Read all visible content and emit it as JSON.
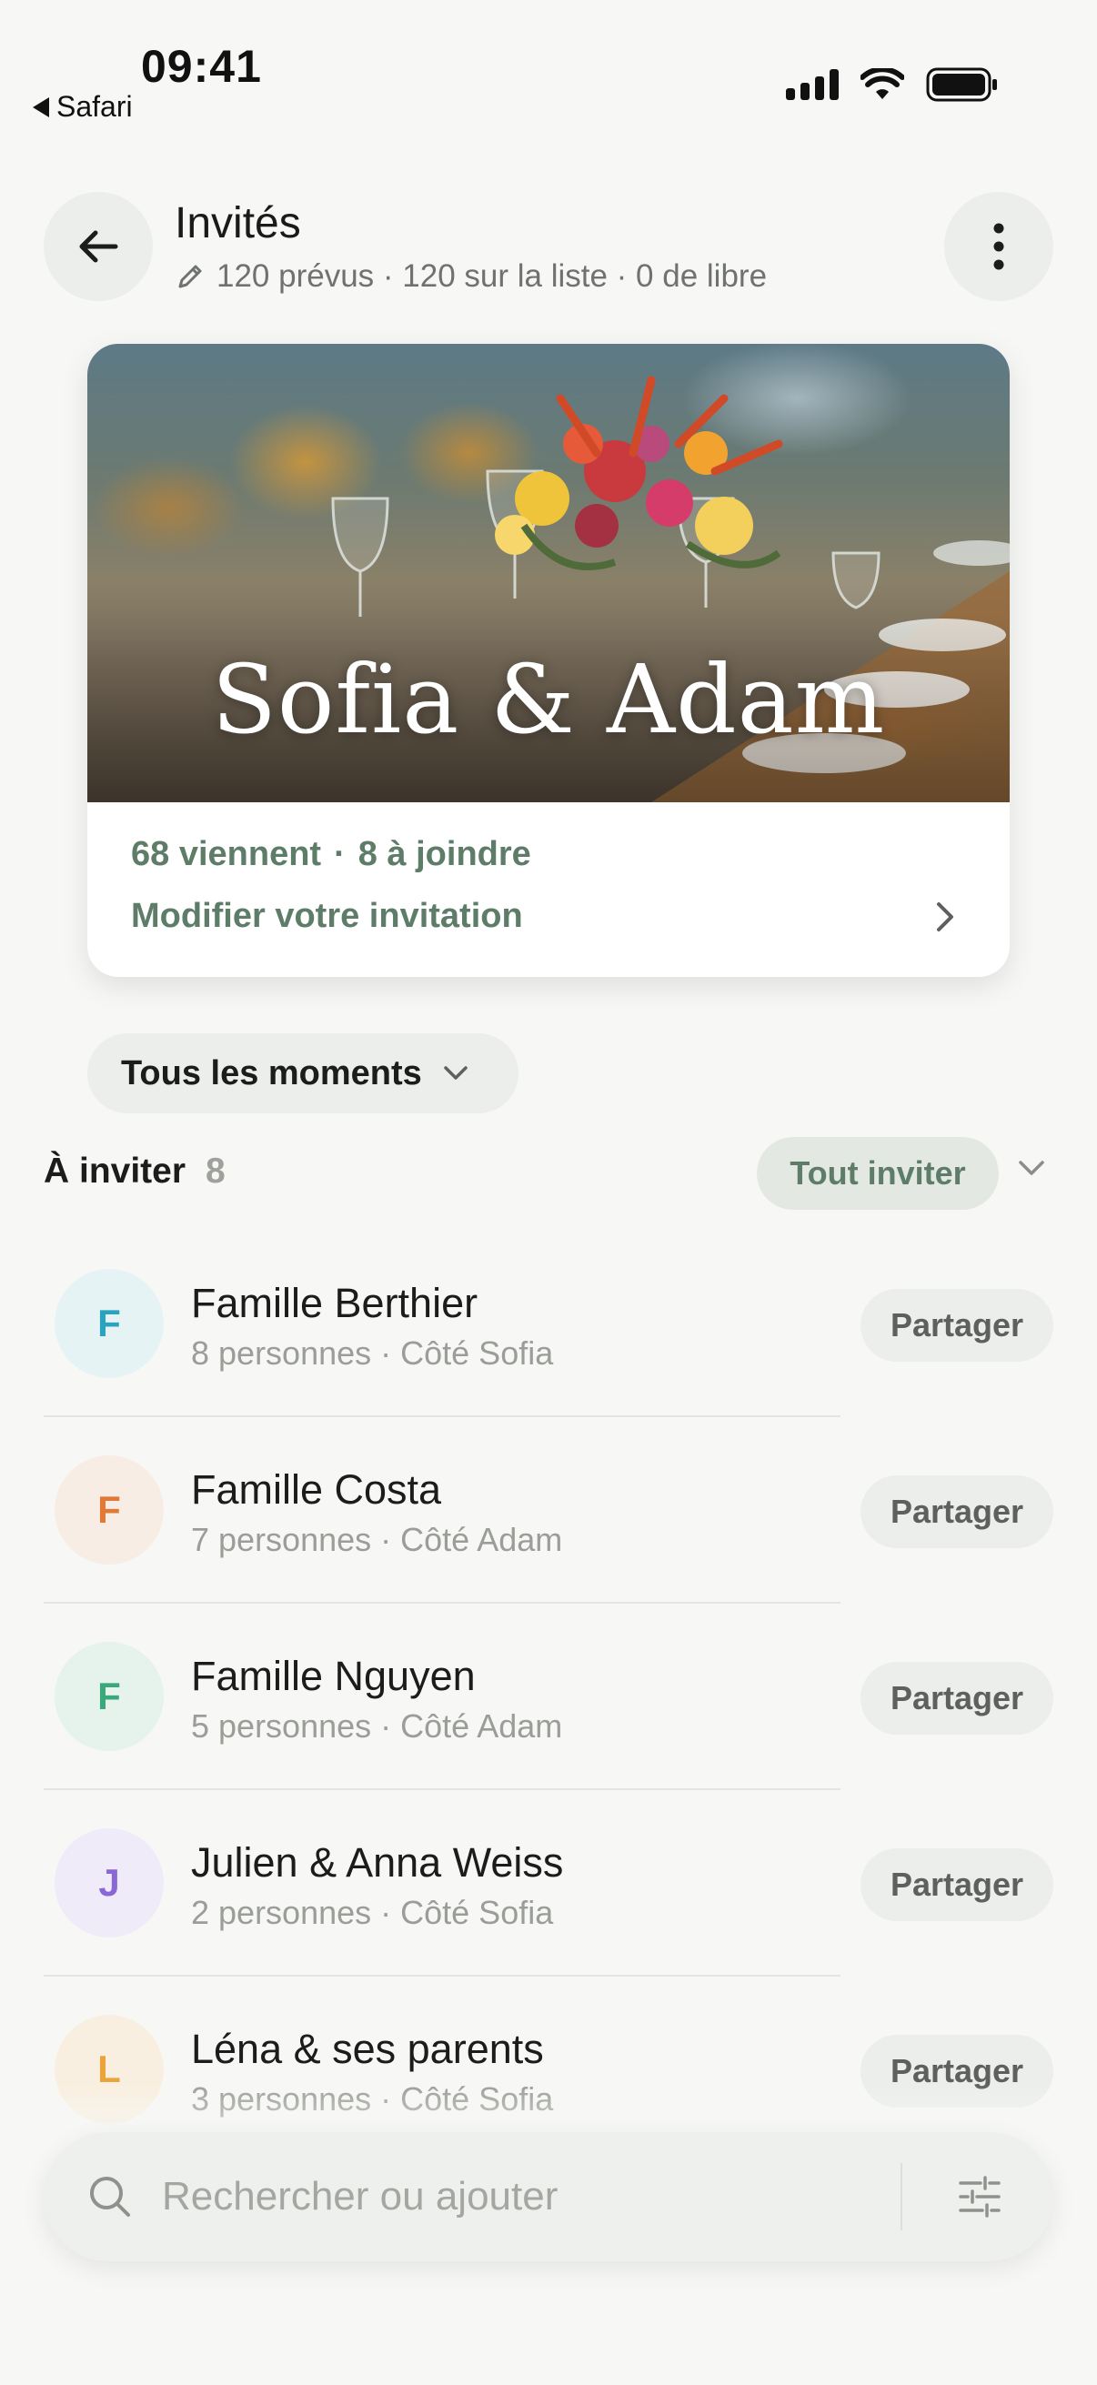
{
  "status_bar": {
    "time": "09:41",
    "back_app": "Safari"
  },
  "header": {
    "title": "Invités",
    "subtitle": "120 prévus · 120 sur la liste · 0 de libre",
    "back_icon": "arrow-left-icon",
    "more_icon": "more-vertical-icon",
    "edit_icon": "pencil-icon"
  },
  "event": {
    "title": "Sofia & Adam",
    "stat_coming": "68 viennent",
    "stat_separator": "·",
    "stat_to_reach": "8 à joindre",
    "edit_label": "Modifier votre invitation"
  },
  "filter": {
    "label": "Tous les moments"
  },
  "section": {
    "title": "À inviter",
    "count": "8",
    "invite_all_label": "Tout inviter"
  },
  "guests": [
    {
      "initial": "F",
      "name": "Famille Berthier",
      "meta": "8 personnes · Côté Sofia",
      "action": "Partager",
      "avatar_bg": "#e6f3f5",
      "avatar_fg": "#2aa3bf"
    },
    {
      "initial": "F",
      "name": "Famille Costa",
      "meta": "7 personnes · Côté Adam",
      "action": "Partager",
      "avatar_bg": "#f8ede4",
      "avatar_fg": "#e27a35"
    },
    {
      "initial": "F",
      "name": "Famille Nguyen",
      "meta": "5 personnes · Côté Adam",
      "action": "Partager",
      "avatar_bg": "#e5f3ec",
      "avatar_fg": "#3aa87b"
    },
    {
      "initial": "J",
      "name": "Julien & Anna Weiss",
      "meta": "2 personnes · Côté Sofia",
      "action": "Partager",
      "avatar_bg": "#efebf8",
      "avatar_fg": "#8a67d4"
    },
    {
      "initial": "L",
      "name": "Léna & ses parents",
      "meta": "3 personnes · Côté Sofia",
      "action": "Partager",
      "avatar_bg": "#f9efe0",
      "avatar_fg": "#eba33b"
    }
  ],
  "search": {
    "placeholder": "Rechercher ou ajouter"
  },
  "colors": {
    "accent": "#5e7d69",
    "background": "#f7f8f6",
    "chip": "#eceeeb"
  }
}
